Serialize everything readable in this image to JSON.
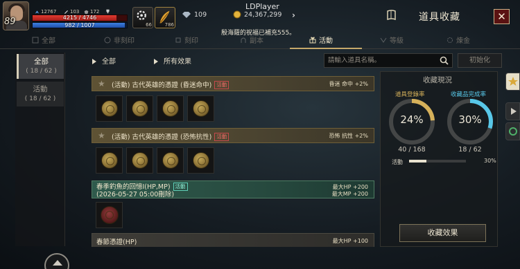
{
  "hud": {
    "level": "89",
    "stat1": "12767",
    "stat2": "103",
    "stat3": "172",
    "hp_text": "4215 / 4746",
    "hp_fraction": 0.888,
    "mp_text": "982 / 1007",
    "mp_fraction": 0.975,
    "slot1_count": "66",
    "slot2_count": "786",
    "app_title": "LDPlayer",
    "diamond": "109",
    "gold": "24,367,299",
    "notice": "殷海薩的祝福已補充555。"
  },
  "panel": {
    "title": "道具收藏",
    "close": "✕"
  },
  "tabs": [
    {
      "label": "全部"
    },
    {
      "label": "非刻印"
    },
    {
      "label": "刻印"
    },
    {
      "label": "副本"
    },
    {
      "label": "活動"
    },
    {
      "label": "等級"
    },
    {
      "label": "煉金"
    }
  ],
  "left_filters": [
    {
      "label": "全部",
      "count": "( 18 / 62 )"
    },
    {
      "label": "活動",
      "count": "( 18 / 62 )"
    }
  ],
  "filters": {
    "dropdown1": "全部",
    "dropdown2": "所有效果",
    "search_placeholder": "請輸入道具名稱。",
    "init_button": "初始化"
  },
  "groups": [
    {
      "name": "(活動) 古代英雄的憑證 (昏迷命中)",
      "badge": "活動",
      "effect": "昏迷 命中 +2%",
      "item_count": 4
    },
    {
      "name": "(活動) 古代英雄的憑證 (恐怖抗性)",
      "badge": "活動",
      "effect": "恐怖 抗性 +2%",
      "item_count": 4
    },
    {
      "name": "春季釣魚的回憶I(HP,MP)",
      "subline": "(2026-05-27 05:00刪除)",
      "badge": "活動",
      "effect1": "最大HP +200",
      "effect2": "最大MP +200",
      "item_count": 1
    },
    {
      "name": "春節憑證(HP)",
      "effect": "最大HP +100"
    }
  ],
  "collection": {
    "title": "收藏現況",
    "ring1_label": "道具登錄率",
    "ring1_pct": "24%",
    "ring1_value": 0.24,
    "ring1_count": "40 / 168",
    "ring2_label": "收藏品完成率",
    "ring2_pct": "30%",
    "ring2_value": 0.3,
    "ring2_count": "18 / 62",
    "category_label": "活動",
    "category_pct": "30%",
    "category_value": 0.3,
    "effect_button": "收藏效果"
  },
  "colors": {
    "accent_gold": "#d6b15a",
    "accent_cyan": "#58c7e8",
    "close_red": "#5a1212"
  }
}
